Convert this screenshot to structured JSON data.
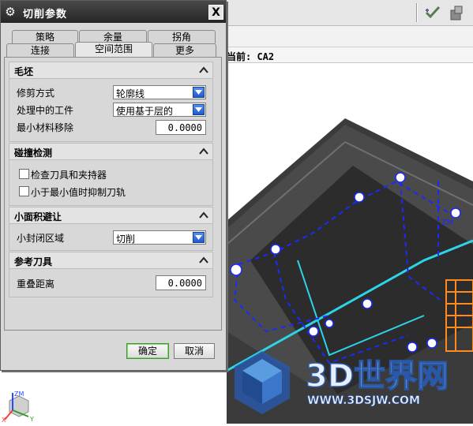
{
  "dialog": {
    "title": "切削参数",
    "close_label": "X",
    "tabs_row1": [
      "策略",
      "余量",
      "拐角"
    ],
    "tabs_row2": [
      "连接",
      "空间范围",
      "更多"
    ],
    "active_tab": "空间范围",
    "sections": {
      "blank": {
        "title": "毛坯",
        "trim_label": "修剪方式",
        "trim_value": "轮廓线",
        "ipw_label": "处理中的工件",
        "ipw_value": "使用基于层的",
        "min_removal_label": "最小材料移除",
        "min_removal_value": "0.0000"
      },
      "collision": {
        "title": "碰撞检测",
        "check_holder_label": "检查刀具和夹持器",
        "check_holder_checked": false,
        "suppress_label": "小于最小值时抑制刀轨",
        "suppress_checked": false
      },
      "small_area": {
        "title": "小面积避让",
        "closed_area_label": "小封闭区域",
        "closed_area_value": "切削"
      },
      "ref_tool": {
        "title": "参考刀具",
        "overlap_label": "重叠距离",
        "overlap_value": "0.0000"
      }
    },
    "ok_label": "确定",
    "cancel_label": "取消"
  },
  "background": {
    "status_text": "当前: CA2",
    "watermark_title": "3D世界网",
    "watermark_url": "WWW.3DSJW.COM",
    "toolbar_icons": [
      "checkmark-tool-icon",
      "part-tool-icon"
    ],
    "axis_labels": {
      "z": "ZM",
      "x": "X",
      "y": "Y"
    }
  }
}
